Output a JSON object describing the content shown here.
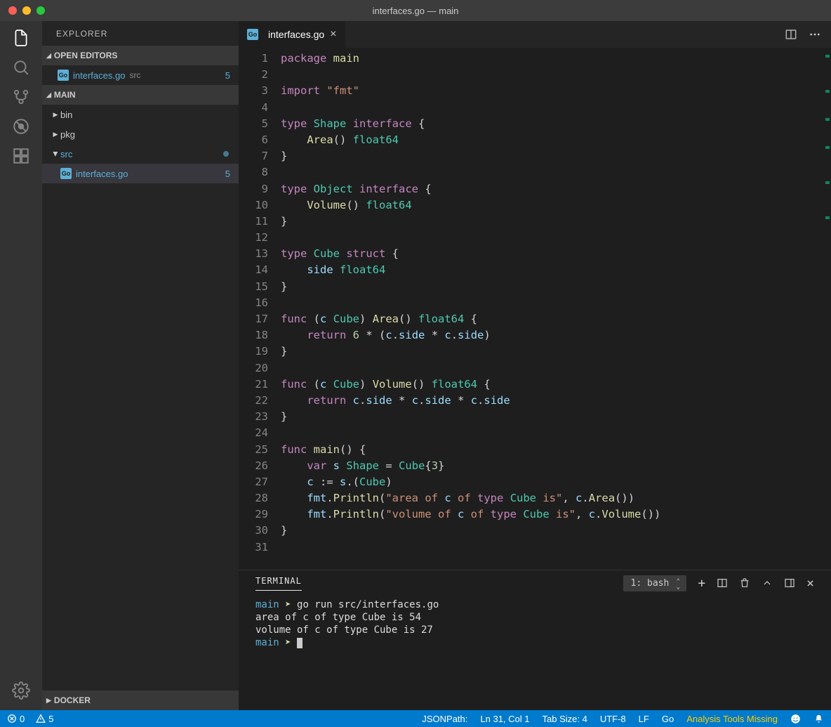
{
  "titlebar": {
    "title": "interfaces.go — main"
  },
  "sidebar": {
    "title": "EXPLORER",
    "open_editors_label": "OPEN EDITORS",
    "open_editor_file": "interfaces.go",
    "open_editor_hint": "src",
    "open_editor_badge": "5",
    "project_label": "MAIN",
    "tree": {
      "bin": "bin",
      "pkg": "pkg",
      "src": "src",
      "src_file": "interfaces.go",
      "src_file_badge": "5"
    },
    "docker_label": "DOCKER"
  },
  "tab": {
    "name": "interfaces.go"
  },
  "code_lines": [
    "package main",
    "",
    "import \"fmt\"",
    "",
    "type Shape interface {",
    "    Area() float64",
    "}",
    "",
    "type Object interface {",
    "    Volume() float64",
    "}",
    "",
    "type Cube struct {",
    "    side float64",
    "}",
    "",
    "func (c Cube) Area() float64 {",
    "    return 6 * (c.side * c.side)",
    "}",
    "",
    "func (c Cube) Volume() float64 {",
    "    return c.side * c.side * c.side",
    "}",
    "",
    "func main() {",
    "    var s Shape = Cube{3}",
    "    c := s.(Cube)",
    "    fmt.Println(\"area of c of type Cube is\", c.Area())",
    "    fmt.Println(\"volume of c of type Cube is\", c.Volume())",
    "}",
    ""
  ],
  "panel": {
    "tab": "TERMINAL",
    "shell": "1: bash",
    "lines": [
      {
        "prompt_dir": "main",
        "prompt_sym": "➤",
        "cmd": " go run src/interfaces.go"
      },
      {
        "text": "area of c of type Cube is 54"
      },
      {
        "text": "volume of c of type Cube is 27"
      },
      {
        "prompt_dir": "main",
        "prompt_sym": "➤",
        "cmd": " ",
        "cursor": true
      }
    ]
  },
  "status": {
    "errors": "0",
    "warnings": "5",
    "jsonpath": "JSONPath:",
    "cursor": "Ln 31, Col 1",
    "tab": "Tab Size: 4",
    "encoding": "UTF-8",
    "eol": "LF",
    "lang": "Go",
    "analysis": "Analysis Tools Missing"
  }
}
